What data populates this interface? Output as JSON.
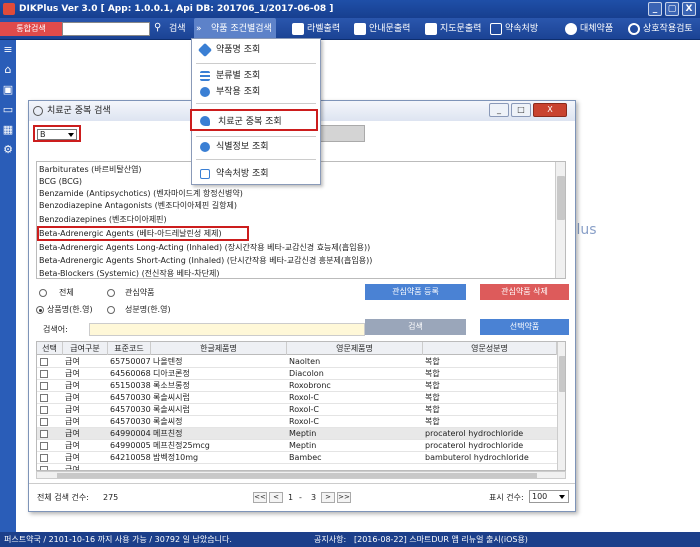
{
  "app": {
    "title": "DIKPlus Ver 3.0 [ App: 1.0.0.1, Api DB: 201706_1/2017-06-08 ]",
    "win_min": "_",
    "win_max": "▢",
    "win_close": "X",
    "bg_text": "Plus"
  },
  "toolbar": {
    "tag": "통합검색",
    "search": "검색",
    "items": [
      "약품 조건별검색",
      "라벨출력",
      "안내문출력",
      "지도문출력",
      "약속처방",
      "대체약품",
      "상호작용검토"
    ]
  },
  "menu": {
    "items": [
      "약품명 조회",
      "분류별 조회",
      "부작용 조회",
      "치료군 중복 조회",
      "식별정보 조회",
      "약속처방 조회"
    ]
  },
  "dialog": {
    "title": "치료군 중복 검색",
    "select_value": "B",
    "min": "_",
    "max": "□",
    "close": "X",
    "classes": [
      "Barbiturates (바르비탈산염)",
      "BCG (BCG)",
      "Benzamide (Antipsychotics) (벤자마이드계 항정신병약)",
      "Benzodiazepine Antagonists (벤조다이아제핀 길항제)",
      "Benzodiazepines (벤조다이아제핀)",
      "Beta-Adrenergic Agents (베타-아드레날린성 제제)",
      "Beta-Adrenergic Agents Long-Acting (Inhaled) (장시간작용 베타-교감신경 효능제(흡입용))",
      "Beta-Adrenergic Agents Short-Acting (Inhaled) (단시간작용 베타-교감신경 흥분제(흡입용))",
      "Beta-Blockers (Systemic) (전신작용 베타-차단제)"
    ],
    "radio_all": "전체",
    "radio_interest": "관심약품",
    "btn_add_interest": "관심약품 등록",
    "btn_del_interest": "관심약품 삭제",
    "radio_product": "상품명(한.영)",
    "radio_ingredient": "성분명(한.영)",
    "keyword_label": "검색어:",
    "btn_search": "검색",
    "btn_select": "선택약품",
    "grid_headers": [
      "선택",
      "급여구분",
      "표준코드",
      "한글제품명",
      "영문제품명",
      "영문성분명"
    ],
    "rows": [
      {
        "pay": "급여",
        "code": "657500070",
        "kname": "나올텐정",
        "ename": "Naolten",
        "ing": "복합"
      },
      {
        "pay": "급여",
        "code": "645600680",
        "kname": "디아코론정",
        "ename": "Diacolon",
        "ing": "복합"
      },
      {
        "pay": "급여",
        "code": "651500380",
        "kname": "록소브롱정",
        "ename": "Roxobronc",
        "ing": "복합"
      },
      {
        "pay": "급여",
        "code": "645700302",
        "kname": "록솔씨시럽",
        "ename": "Roxol-C",
        "ing": "복합"
      },
      {
        "pay": "급여",
        "code": "645700303",
        "kname": "록솔씨시럽",
        "ename": "Roxol-C",
        "ing": "복합"
      },
      {
        "pay": "급여",
        "code": "645700301",
        "kname": "록솔씨정",
        "ename": "Roxol-C",
        "ing": "복합"
      },
      {
        "pay": "급여",
        "code": "649900040",
        "kname": "메프친정",
        "ename": "Meptin",
        "ing": "procaterol hydrochloride"
      },
      {
        "pay": "급여",
        "code": "649900050",
        "kname": "메프친정25mcg",
        "ename": "Meptin",
        "ing": "procaterol hydrochloride"
      },
      {
        "pay": "급여",
        "code": "642100580",
        "kname": "밤벡정10mg",
        "ename": "Bambec",
        "ing": "bambuterol hydrochloride"
      },
      {
        "pay": "급여",
        "code": "",
        "kname": "",
        "ename": "",
        "ing": ""
      }
    ],
    "total_label": "전체 검색 건수:",
    "total": "275",
    "pg_first": "<<",
    "pg_prev": "<",
    "pg_page": "1",
    "pg_sep": "-",
    "pg_total": "3",
    "pg_next": ">",
    "pg_last": ">>",
    "perpage_label": "표시 건수:",
    "perpage": "100"
  },
  "status": {
    "left": "퍼스트약국 / 2101-10-16 까지 사용 가능 / 30792 일 남았습니다.",
    "notice_label": "공지사항:",
    "notice": "[2016-08-22] 스마트DUR 앱 리뉴얼 출시(iOS용)"
  }
}
